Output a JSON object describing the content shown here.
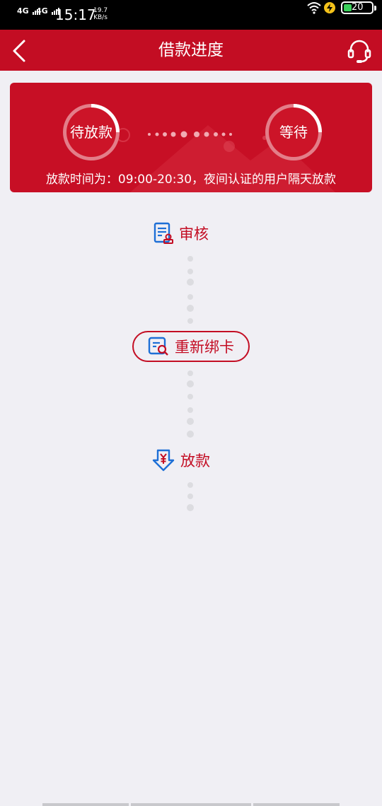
{
  "status_bar": {
    "signal1": "4G",
    "signal2": "4G",
    "time": "15:17",
    "speed_value": "19.7",
    "speed_unit": "KB/s",
    "battery": "20"
  },
  "header": {
    "title": "借款进度"
  },
  "banner": {
    "left_status": "待放款",
    "right_status": "等待",
    "note": "放款时间为：09:00-20:30，夜间认证的用户隔天放款"
  },
  "steps": {
    "review": "审核",
    "rebind_card": "重新绑卡",
    "disburse": "放款"
  },
  "colors": {
    "brand_red": "#c30d23",
    "background": "#f0eff4",
    "icon_blue": "#1d6fd6"
  }
}
